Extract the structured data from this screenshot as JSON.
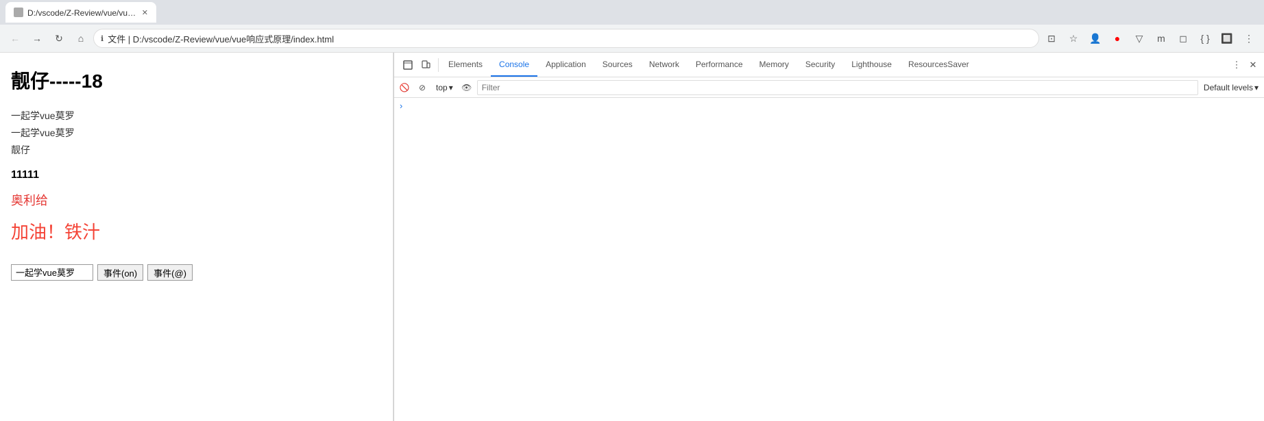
{
  "browser": {
    "tab_title": "D:/vscode/Z-Review/vue/vue响应式原理/index.html",
    "address": "文件 | D:/vscode/Z-Review/vue/vue响应式原理/index.html",
    "back_btn": "←",
    "forward_btn": "→",
    "reload_btn": "↻",
    "home_btn": "⌂",
    "lock_icon": "ℹ"
  },
  "page": {
    "title": "靓仔-----18",
    "line1": "一起学vue莫罗",
    "line2": "一起学vue莫罗",
    "line3": "靓仔",
    "bold_text": "11111",
    "red_medium": "奥利给",
    "red_large": "加油！铁汁",
    "input_value": "一起学vue莫罗",
    "btn1_label": "事件(on)",
    "btn2_label": "事件(@)"
  },
  "devtools": {
    "tabs": [
      {
        "id": "elements",
        "label": "Elements",
        "active": false
      },
      {
        "id": "console",
        "label": "Console",
        "active": true
      },
      {
        "id": "application",
        "label": "Application",
        "active": false
      },
      {
        "id": "sources",
        "label": "Sources",
        "active": false
      },
      {
        "id": "network",
        "label": "Network",
        "active": false
      },
      {
        "id": "performance",
        "label": "Performance",
        "active": false
      },
      {
        "id": "memory",
        "label": "Memory",
        "active": false
      },
      {
        "id": "security",
        "label": "Security",
        "active": false
      },
      {
        "id": "lighthouse",
        "label": "Lighthouse",
        "active": false
      },
      {
        "id": "resourcessaver",
        "label": "ResourcesSaver",
        "active": false
      }
    ],
    "console": {
      "context": "top",
      "filter_placeholder": "Filter",
      "default_levels": "Default levels"
    }
  }
}
